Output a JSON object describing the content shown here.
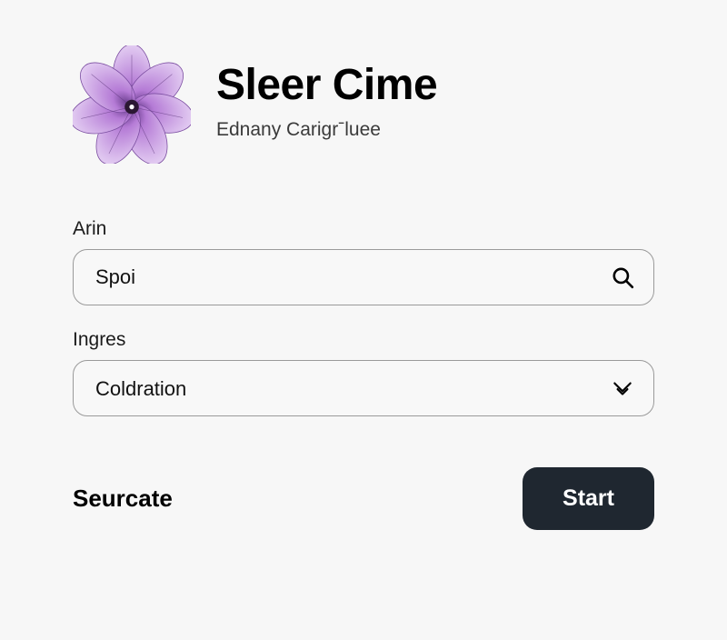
{
  "header": {
    "title": "Sleer Cime",
    "subtitle": "Ednany Carigrˉluee"
  },
  "fields": {
    "arin": {
      "label": "Arin",
      "value": "Spoi"
    },
    "ingres": {
      "label": "Ingres",
      "selected": "Coldration"
    }
  },
  "footer": {
    "label": "Seurcate",
    "button": "Start"
  },
  "colors": {
    "button_bg": "#1f2730",
    "border": "#9a9a9a",
    "flower_primary": "#b57bd6",
    "flower_light": "#d9b8ec",
    "flower_dark": "#6b3d8f"
  }
}
